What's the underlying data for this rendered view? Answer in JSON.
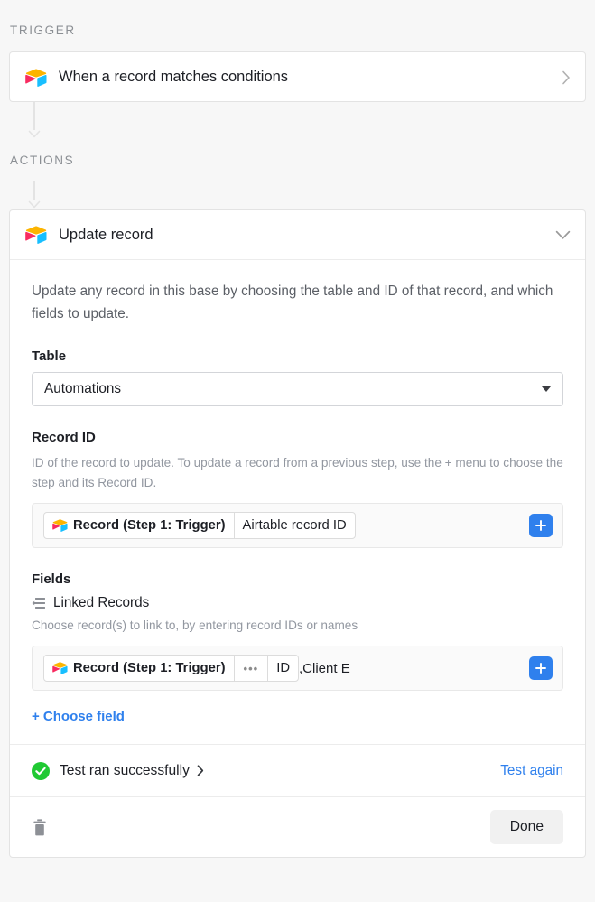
{
  "sections": {
    "trigger_label": "TRIGGER",
    "actions_label": "ACTIONS"
  },
  "trigger": {
    "title": "When a record matches conditions",
    "icon": "airtable-cube-icon",
    "chevron": "chevron-right-icon"
  },
  "action": {
    "title": "Update record",
    "icon": "airtable-cube-icon",
    "chevron": "chevron-down-icon",
    "description": "Update any record in this base by choosing the table and ID of that record, and which fields to update.",
    "table": {
      "label": "Table",
      "value": "Automations"
    },
    "record_id": {
      "label": "Record ID",
      "help": "ID of the record to update. To update a record from a previous step, use the + menu to choose the step and its Record ID.",
      "token_step": "Record (Step 1: Trigger)",
      "token_field": "Airtable record ID",
      "add_button": "+"
    },
    "fields": {
      "label": "Fields",
      "linked_records": {
        "name": "Linked Records",
        "icon": "linked-records-icon",
        "help": "Choose record(s) to link to, by entering record IDs or names",
        "token_step": "Record (Step 1: Trigger)",
        "token_ellipsis": "•••",
        "token_id": "ID",
        "token_tail": ",Client E",
        "add_button": "+"
      },
      "choose_field_label": "+ Choose field"
    },
    "test": {
      "status_text": "Test ran successfully",
      "status_icon": "green-check-icon",
      "chevron": "chevron-right-icon",
      "test_again_label": "Test again"
    },
    "footer": {
      "delete_icon": "trash-icon",
      "done_label": "Done"
    }
  },
  "colors": {
    "accent_blue": "#2f80ed",
    "success_green": "#20c933",
    "page_background": "#f7f7f7",
    "card_background": "#ffffff",
    "border": "#e3e3e3",
    "muted_text": "#9297a0"
  }
}
